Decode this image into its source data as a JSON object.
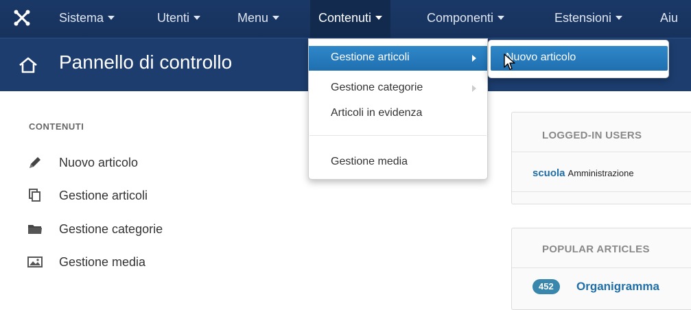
{
  "navbar": {
    "logo_icon": "joomla-logo-icon",
    "items": [
      {
        "label": "Sistema"
      },
      {
        "label": "Utenti"
      },
      {
        "label": "Menu"
      },
      {
        "label": "Contenuti"
      },
      {
        "label": "Componenti"
      },
      {
        "label": "Estensioni"
      },
      {
        "label": "Aiu"
      }
    ],
    "active_item": "Contenuti"
  },
  "header": {
    "icon": "home-icon",
    "title": "Pannello di controllo"
  },
  "sidebar": {
    "heading": "CONTENUTI",
    "items": [
      {
        "label": "Nuovo articolo",
        "icon": "pencil-icon"
      },
      {
        "label": "Gestione articoli",
        "icon": "copy-icon"
      },
      {
        "label": "Gestione categorie",
        "icon": "folder-icon"
      },
      {
        "label": "Gestione media",
        "icon": "image-icon"
      }
    ]
  },
  "dropdown": {
    "items": [
      {
        "label": "Gestione articoli"
      },
      {
        "label": "Gestione categorie"
      },
      {
        "label": "Articoli in evidenza"
      },
      {
        "label": "Gestione media"
      }
    ],
    "submenu": {
      "items": [
        {
          "label": "Nuovo articolo"
        }
      ]
    }
  },
  "logged_in_users": {
    "heading": "LOGGED-IN USERS",
    "users": [
      {
        "name": "scuola",
        "role": "Amministrazione"
      }
    ]
  },
  "popular_articles": {
    "heading": "POPULAR ARTICLES",
    "articles": [
      {
        "hits": "452",
        "title": "Organigramma"
      }
    ]
  },
  "colors": {
    "navbar_bg": "#1a3867",
    "header_bg": "#1c3d6e",
    "highlight": "#2f88c9",
    "link": "#1f6ea8"
  }
}
